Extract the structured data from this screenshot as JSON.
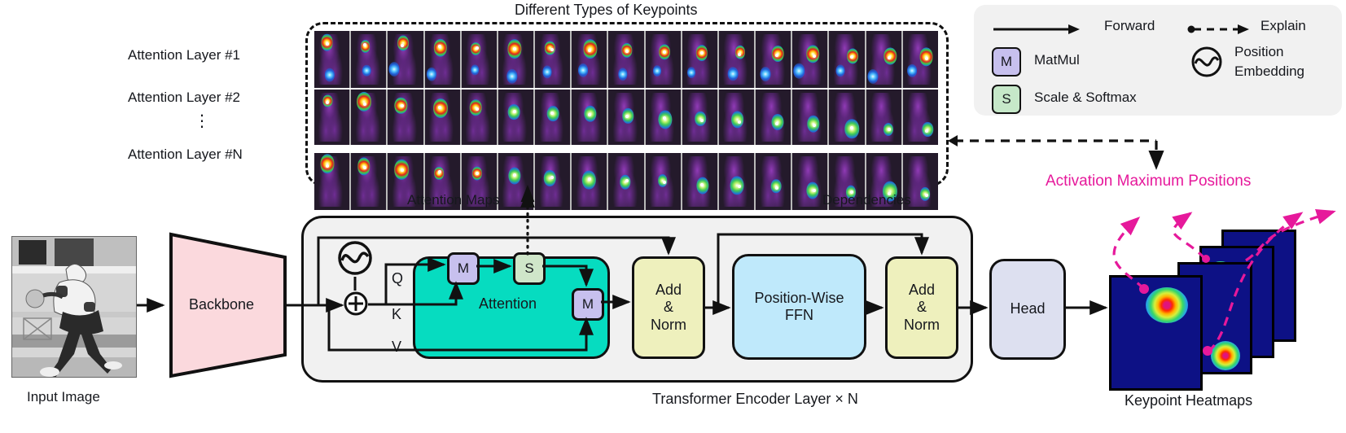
{
  "titles": {
    "top": "Different Types of Keypoints",
    "attention_maps": "Attention Maps",
    "dependencies": "Dependencies",
    "encoder": "Transformer Encoder Layer × N",
    "input_image": "Input Image",
    "keypoint_heatmaps": "Keypoint Heatmaps",
    "activation_max": "Activation Maximum Positions"
  },
  "layers": {
    "l1": "Attention Layer #1",
    "l2": "Attention Layer #2",
    "ellipsis": "⋮",
    "ln": "Attention Layer #N"
  },
  "legend": {
    "forward": "Forward",
    "explain": "Explain",
    "matmul": "MatMul",
    "matmul_symbol": "M",
    "scale_softmax": "Scale & Softmax",
    "scale_symbol": "S",
    "position_embedding_line1": "Position",
    "position_embedding_line2": "Embedding",
    "icons": {
      "forward_arrow": "forward-arrow-icon",
      "explain_arrow": "explain-dashed-arrow-icon",
      "position_embedding": "position-embedding-sine-circle-icon"
    }
  },
  "blocks": {
    "backbone": "Backbone",
    "attention": "Attention",
    "matmul_1": "M",
    "softmax": "S",
    "matmul_2": "M",
    "add_norm_1_l1": "Add",
    "add_norm_1_l2": "&",
    "add_norm_1_l3": "Norm",
    "ffn_l1": "Position-Wise",
    "ffn_l2": "FFN",
    "add_norm_2_l1": "Add",
    "add_norm_2_l2": "&",
    "add_norm_2_l3": "Norm",
    "head": "Head"
  },
  "qkv": {
    "q": "Q",
    "k": "K",
    "v": "V"
  },
  "colors": {
    "attention_block": "#06dcc0",
    "add_norm": "#eef0bd",
    "ffn": "#bfe9fb",
    "head": "#dde0f0",
    "backbone": "#fbd9dd",
    "matmul_chip": "#c7c0ee",
    "softmax_chip": "#c6e8c9",
    "encoder_bg": "#f1f1f1",
    "legend_bg": "#f1f1f1",
    "accent_magenta": "#e6199b",
    "heatmap_bg": "#0d1185",
    "qkv_label": "#16181d"
  },
  "attention_grid": {
    "rows": 3,
    "cols": 17
  },
  "heatmap_stack": {
    "count": 4
  }
}
